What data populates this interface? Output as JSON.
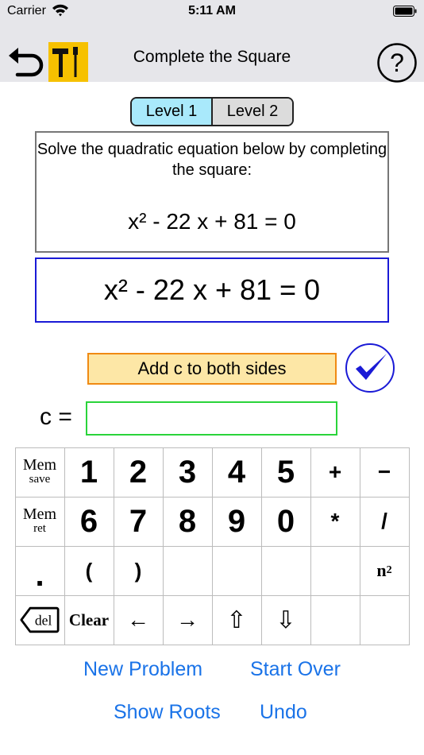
{
  "status_bar": {
    "carrier": "Carrier",
    "time": "5:11 AM"
  },
  "nav": {
    "title": "Complete the Square",
    "help": "?"
  },
  "levels": [
    "Level 1",
    "Level 2"
  ],
  "selected_level": "Level 1",
  "problem": {
    "instruction": "Solve the quadratic equation below by completing the square:",
    "equation": "x² - 22 x + 81 = 0"
  },
  "work": {
    "equation": "x² - 22 x + 81 = 0"
  },
  "hint": {
    "label": "Add c to both sides"
  },
  "c_entry": {
    "label": "c =",
    "value": ""
  },
  "keypad": {
    "row1": {
      "mem": "Mem",
      "mem_sub": "save",
      "k1": "1",
      "k2": "2",
      "k3": "3",
      "k4": "4",
      "k5": "5",
      "plus": "+",
      "minus": "−"
    },
    "row2": {
      "mem": "Mem",
      "mem_sub": "ret",
      "k6": "6",
      "k7": "7",
      "k8": "8",
      "k9": "9",
      "k0": "0",
      "times": "*",
      "divide": "/"
    },
    "row3": {
      "dot": ".",
      "lparen": "(",
      "rparen": ")",
      "power_base": "n",
      "power_exp": "2"
    },
    "row4": {
      "del": "del",
      "clear": "Clear",
      "left": "←",
      "right": "→",
      "up": "⇧",
      "down": "⇩"
    }
  },
  "actions": {
    "new_problem": "New Problem",
    "start_over": "Start Over",
    "show_roots": "Show Roots",
    "undo": "Undo"
  },
  "colors": {
    "tools_button": "#f6c100",
    "level_selected": "#a9e9fb",
    "hint_fill": "#fde7a6",
    "hint_border": "#f08a13",
    "work_border": "#1a1ad6",
    "input_border": "#2ad43a",
    "link": "#1a73e8",
    "check": "#1a1ad6"
  },
  "icons": [
    "wifi-icon",
    "battery-icon",
    "back-arrow-icon",
    "tools-icon",
    "help-icon",
    "checkmark-icon",
    "backspace-icon",
    "arrow-left-icon",
    "arrow-right-icon",
    "arrow-up-icon",
    "arrow-down-icon"
  ]
}
